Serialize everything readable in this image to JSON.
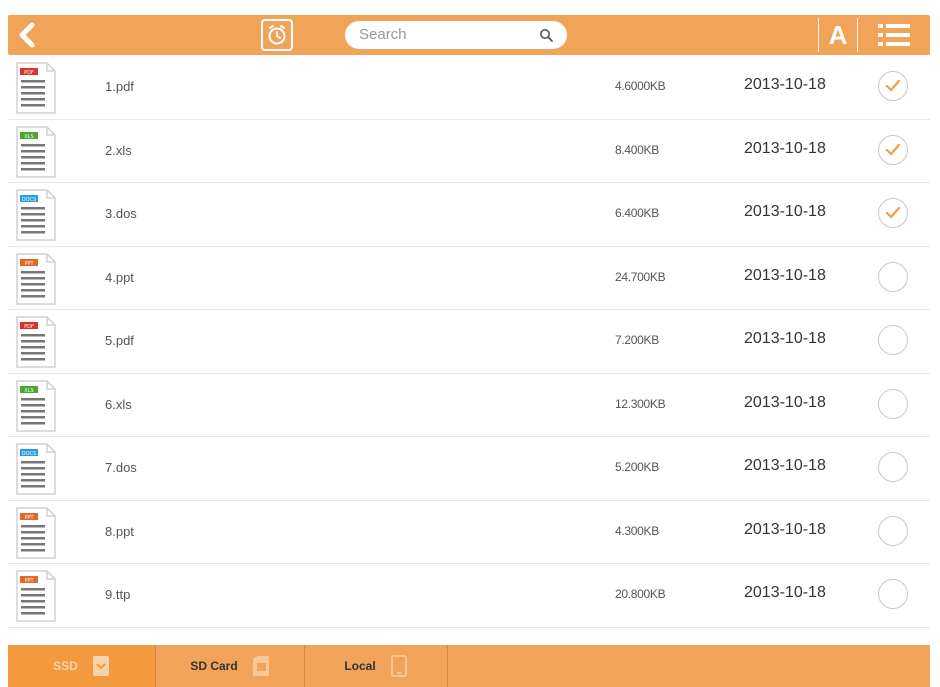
{
  "header": {
    "search_placeholder": "Search",
    "font_button_label": "A",
    "icons": {
      "back": "back-arrow-icon",
      "timer": "alarm-clock-icon",
      "search": "search-icon",
      "list": "list-view-icon"
    }
  },
  "files": [
    {
      "name": "1.pdf",
      "size": "4.6000KB",
      "date": "2013-10-18",
      "type_label": "PDF",
      "type_color": "#d9342b",
      "checked": true
    },
    {
      "name": "2.xls",
      "size": "8.400KB",
      "date": "2013-10-18",
      "type_label": "XLS",
      "type_color": "#4aa832",
      "checked": true
    },
    {
      "name": "3.dos",
      "size": "6.400KB",
      "date": "2013-10-18",
      "type_label": "DOCS",
      "type_color": "#2a9de0",
      "checked": true
    },
    {
      "name": "4.ppt",
      "size": "24.700KB",
      "date": "2013-10-18",
      "type_label": "PPT",
      "type_color": "#e5672a",
      "checked": false
    },
    {
      "name": "5.pdf",
      "size": "7.200KB",
      "date": "2013-10-18",
      "type_label": "PDF",
      "type_color": "#d9342b",
      "checked": false
    },
    {
      "name": "6.xls",
      "size": "12.300KB",
      "date": "2013-10-18",
      "type_label": "XLS",
      "type_color": "#4aa832",
      "checked": false
    },
    {
      "name": "7.dos",
      "size": "5.200KB",
      "date": "2013-10-18",
      "type_label": "DOCS",
      "type_color": "#2a9de0",
      "checked": false
    },
    {
      "name": "8.ppt",
      "size": "4.300KB",
      "date": "2013-10-18",
      "type_label": "PPT",
      "type_color": "#e5672a",
      "checked": false
    },
    {
      "name": "9.ttp",
      "size": "20.800KB",
      "date": "2013-10-18",
      "type_label": "PPT",
      "type_color": "#e5672a",
      "checked": false
    }
  ],
  "bottom_tabs": [
    {
      "label": "SSD",
      "icon": "ssd-icon",
      "active": true
    },
    {
      "label": "SD Card",
      "icon": "sd-card-icon",
      "active": false
    },
    {
      "label": "Local",
      "icon": "phone-icon",
      "active": false
    }
  ],
  "colors": {
    "accent": "#f1a35a",
    "check_orange": "#f0a040"
  }
}
